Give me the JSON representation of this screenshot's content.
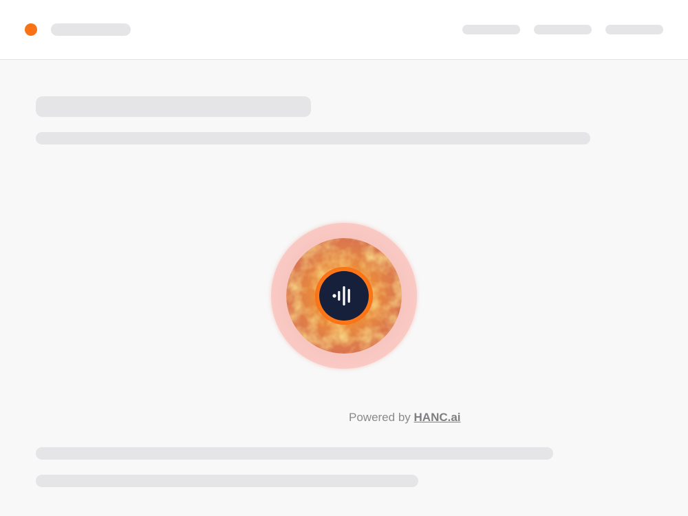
{
  "colors": {
    "accent": "#f97316",
    "skeleton": "#e5e5e8",
    "button_dark": "#17203a",
    "page_bg": "#f8f8f8",
    "header_bg": "#ffffff"
  },
  "header": {
    "logo_icon": "orange-dot-icon"
  },
  "voice_widget": {
    "icon": "audio-waveform-icon"
  },
  "footer": {
    "powered_prefix": "Powered by",
    "brand_link": "HANC.ai"
  }
}
